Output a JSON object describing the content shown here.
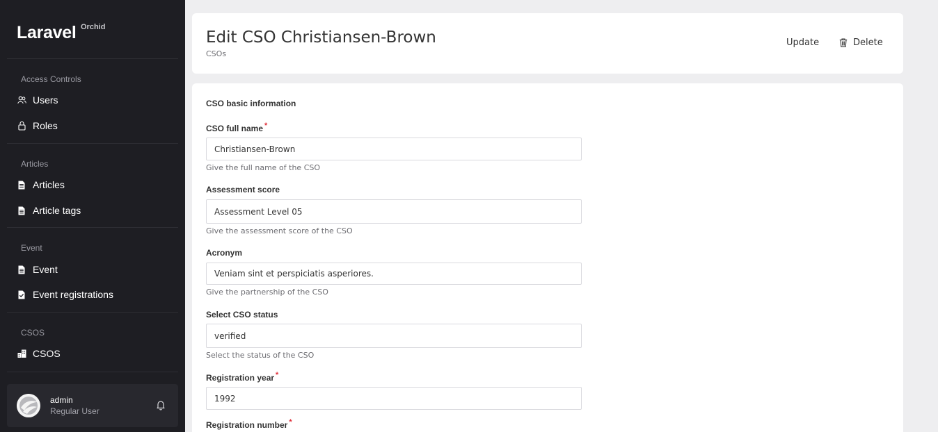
{
  "brand": {
    "name": "Laravel",
    "sup": "Orchid"
  },
  "sidebar": {
    "sections": [
      {
        "title": "Access Controls",
        "items": [
          {
            "label": "Users",
            "icon": "users-icon"
          },
          {
            "label": "Roles",
            "icon": "lock-icon"
          }
        ]
      },
      {
        "title": "Articles",
        "items": [
          {
            "label": "Articles",
            "icon": "document-icon"
          },
          {
            "label": "Article tags",
            "icon": "document-icon"
          }
        ]
      },
      {
        "title": "Event",
        "items": [
          {
            "label": "Event",
            "icon": "document-icon"
          },
          {
            "label": "Event registrations",
            "icon": "document-check-icon"
          }
        ]
      },
      {
        "title": "CSOS",
        "items": [
          {
            "label": "CSOS",
            "icon": "building-icon"
          }
        ]
      }
    ],
    "user": {
      "name": "admin",
      "role": "Regular User"
    }
  },
  "header": {
    "title": "Edit CSO Christiansen-Brown",
    "subtitle": "CSOs",
    "update_label": "Update",
    "delete_label": "Delete"
  },
  "form": {
    "heading": "CSO basic information",
    "fields": [
      {
        "label": "CSO full name",
        "required": "*",
        "value": "Christiansen-Brown",
        "help": "Give the full name of the CSO"
      },
      {
        "label": "Assessment score",
        "value": "Assessment Level 05",
        "help": "Give the assessment score of the CSO"
      },
      {
        "label": "Acronym",
        "value": "Veniam sint et perspiciatis asperiores.",
        "help": "Give the partnership of the CSO"
      },
      {
        "label": "Select CSO status",
        "value": "verified",
        "help": "Select the status of the CSO"
      },
      {
        "label": "Registration year",
        "required": "*",
        "value": "1992"
      },
      {
        "label": "Registration number",
        "required": "*"
      }
    ]
  },
  "colors": {
    "sidebar_bg": "#1e1e23",
    "page_bg": "#eeeef0",
    "required": "#e0303a"
  }
}
